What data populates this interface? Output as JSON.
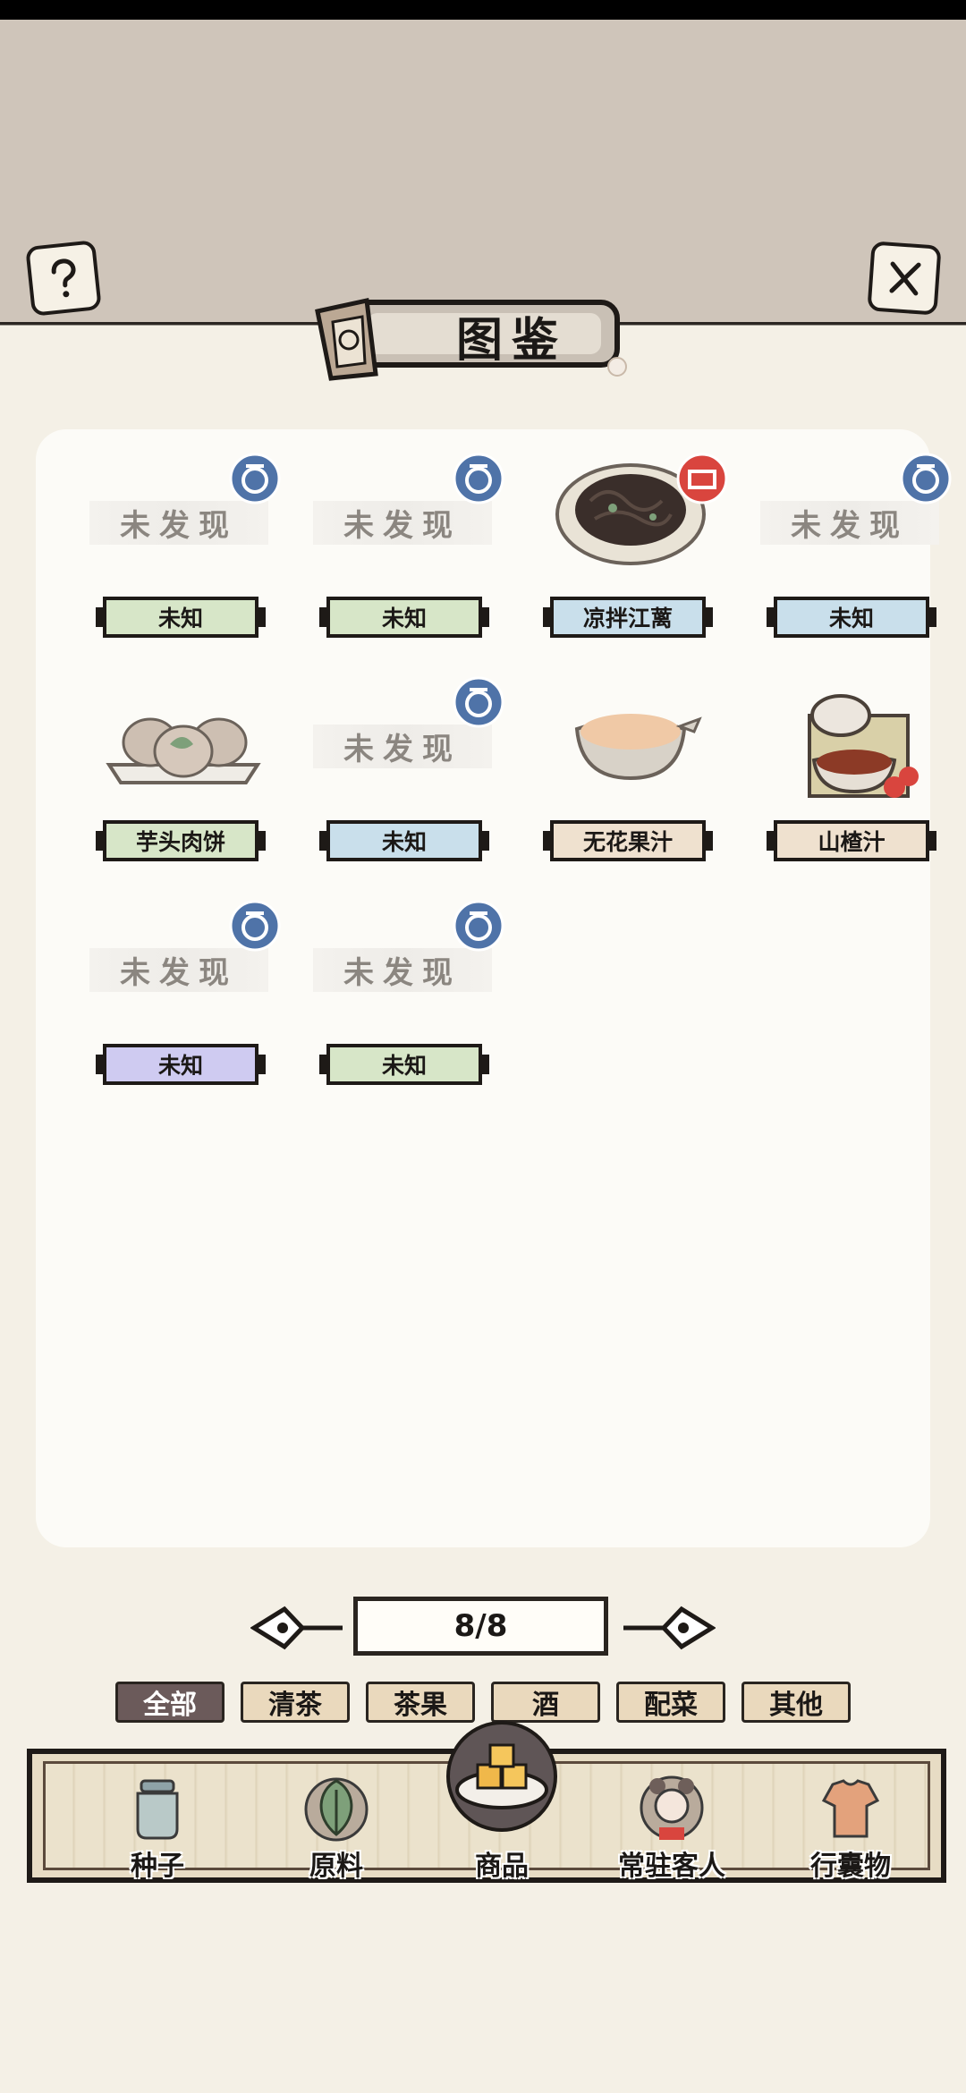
{
  "header": {
    "title": "图鉴"
  },
  "grid": [
    {
      "discovered": false,
      "unknown_text": "未发现",
      "label": "未知",
      "label_color": "green",
      "badge": "plate-badge-icon"
    },
    {
      "discovered": false,
      "unknown_text": "未发现",
      "label": "未知",
      "label_color": "green",
      "badge": "plate-badge-icon"
    },
    {
      "discovered": true,
      "label": "凉拌江蓠",
      "label_color": "blue",
      "badge": "new-badge-icon",
      "image": "seaweed-dish-icon"
    },
    {
      "discovered": false,
      "unknown_text": "未发现",
      "label": "未知",
      "label_color": "blue",
      "badge": "plate-badge-icon"
    },
    {
      "discovered": true,
      "label": "芋头肉饼",
      "label_color": "green",
      "image": "taro-cakes-icon"
    },
    {
      "discovered": false,
      "unknown_text": "未发现",
      "label": "未知",
      "label_color": "blue",
      "badge": "plate-badge-icon"
    },
    {
      "discovered": true,
      "label": "无花果汁",
      "label_color": "tan",
      "image": "fig-juice-icon"
    },
    {
      "discovered": true,
      "label": "山楂汁",
      "label_color": "tan",
      "image": "hawthorn-juice-icon"
    },
    {
      "discovered": false,
      "unknown_text": "未发现",
      "label": "未知",
      "label_color": "purple",
      "badge": "plate-badge-icon"
    },
    {
      "discovered": false,
      "unknown_text": "未发现",
      "label": "未知",
      "label_color": "green",
      "badge": "plate-badge-icon"
    }
  ],
  "pager": {
    "text": "8/8",
    "current": 8,
    "total": 8
  },
  "filters": [
    {
      "label": "全部",
      "active": true
    },
    {
      "label": "清茶",
      "active": false
    },
    {
      "label": "茶果",
      "active": false
    },
    {
      "label": "酒",
      "active": false
    },
    {
      "label": "配菜",
      "active": false
    },
    {
      "label": "其他",
      "active": false
    }
  ],
  "bottom_nav": [
    {
      "label": "种子",
      "icon": "seed-jar-icon",
      "active": false
    },
    {
      "label": "原料",
      "icon": "tea-leaf-icon",
      "active": false
    },
    {
      "label": "商品",
      "icon": "goods-plate-icon",
      "active": true
    },
    {
      "label": "常驻客人",
      "icon": "girl-avatar-icon",
      "active": false
    },
    {
      "label": "行囊物",
      "icon": "clothes-icon",
      "active": false
    }
  ],
  "colors": {
    "label_green": "#d7e6c8",
    "label_blue": "#c9dfeb",
    "label_tan": "#efe1cf",
    "label_purple": "#cfcbf1",
    "badge_blue": "#4f73a8",
    "badge_red": "#d9453e",
    "active_filter": "#6b5a5a"
  }
}
